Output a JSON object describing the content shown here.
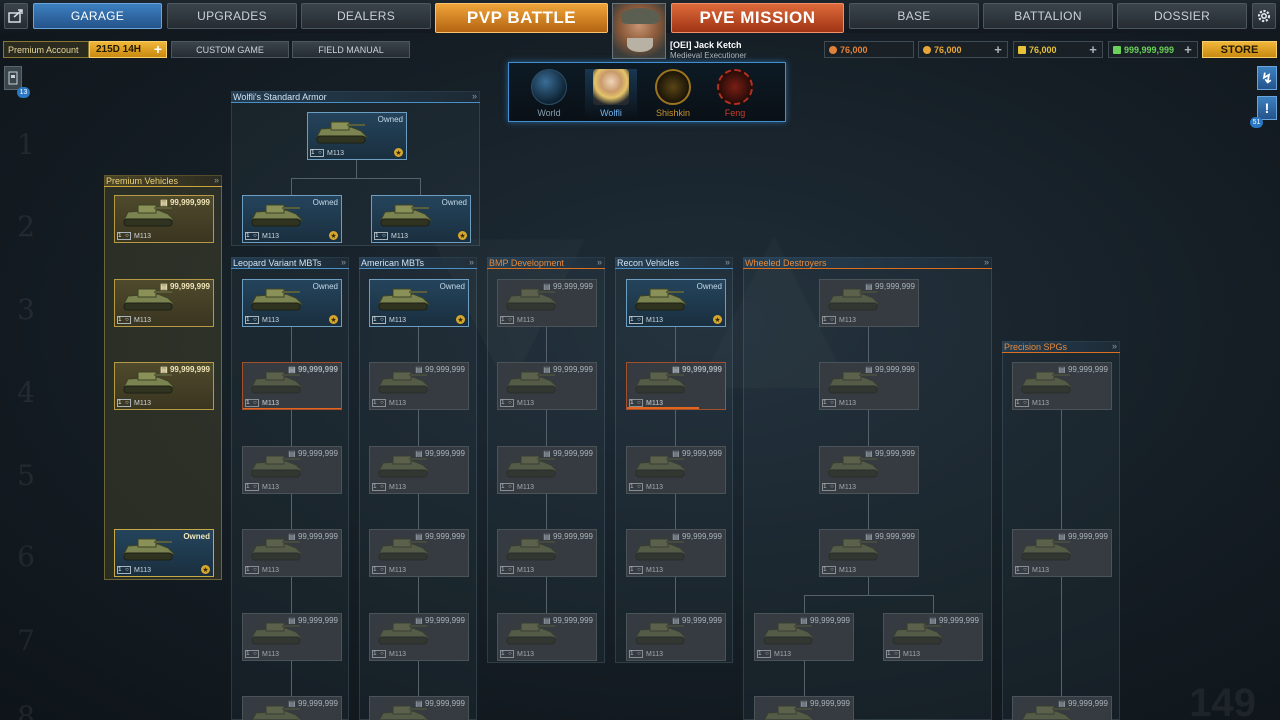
{
  "nav": {
    "garage": "GARAGE",
    "upgrades": "UPGRADES",
    "dealers": "DEALERS",
    "pvp": "PVP BATTLE",
    "pve": "PVE MISSION",
    "base": "BASE",
    "battalion": "BATTALION",
    "dossier": "DOSSIER",
    "share_icon": "share-icon",
    "settings_icon": "gear-icon"
  },
  "subbar": {
    "premium_label": "Premium Account",
    "premium_time": "215D 14H",
    "custom_game": "CUSTOM GAME",
    "field_manual": "FIELD MANUAL"
  },
  "player": {
    "name": "[OEI] Jack Ketch",
    "title": "Medieval Executioner"
  },
  "resources": [
    {
      "value": "76,000",
      "color": "#e0823a"
    },
    {
      "value": "76,000",
      "color": "#e7a738"
    },
    {
      "value": "76,000",
      "color": "#e6c13a"
    },
    {
      "value": "999,999,999",
      "color": "#6ad15a"
    }
  ],
  "store": "STORE",
  "factions": [
    {
      "name": "World",
      "color": "#8aa0b0"
    },
    {
      "name": "Wolfli",
      "color": "#6fb3ef"
    },
    {
      "name": "Shishkin",
      "color": "#c9952c"
    },
    {
      "name": "Feng",
      "color": "#cc3b2a"
    }
  ],
  "badges": {
    "left": "13",
    "right": "51"
  },
  "row_numbers": [
    "1",
    "2",
    "3",
    "4",
    "5",
    "6",
    "7",
    "8"
  ],
  "watermark_number": "149",
  "trees": [
    {
      "title": "Wolfli's Standard Armor"
    },
    {
      "title": "Premium Vehicles"
    },
    {
      "title": "Leopard Variant MBTs"
    },
    {
      "title": "American MBTs"
    },
    {
      "title": "BMP Development"
    },
    {
      "title": "Recon Vehicles"
    },
    {
      "title": "Wheeled Destroyers"
    },
    {
      "title": "Precision SPGs"
    }
  ],
  "vehicle": {
    "name": "M113",
    "tier": "1",
    "owned": "Owned",
    "price": "99,999,999"
  }
}
